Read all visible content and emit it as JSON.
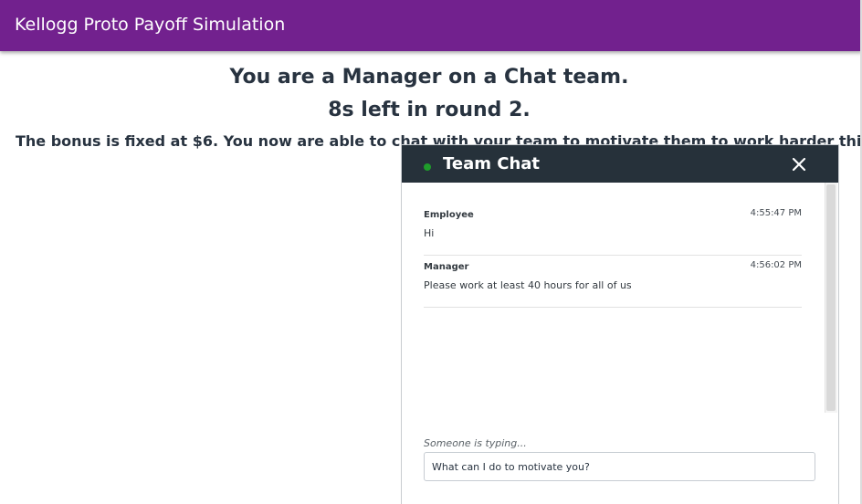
{
  "header": {
    "app_title": "Kellogg Proto Payoff Simulation"
  },
  "main": {
    "role_line": "You are a Manager on a Chat team.",
    "timer_line": "8s left in round 2.",
    "bonus_line": "The bonus is fixed at $6. You now are able to chat with your team to motivate them to work harder this"
  },
  "chat": {
    "title": "Team Chat",
    "online_dot_color": "#1f9d2b",
    "messages": [
      {
        "author": "Employee",
        "time": "4:55:47 PM",
        "text": "Hi"
      },
      {
        "author": "Manager",
        "time": "4:56:02 PM",
        "text": "Please work at least 40 hours for all of us"
      }
    ],
    "typing_indicator": "Someone is typing...",
    "input_value": "What can I do to motivate you?"
  },
  "colors": {
    "brand": "#72218e",
    "chat_header": "#26313a",
    "text": "#283340"
  }
}
